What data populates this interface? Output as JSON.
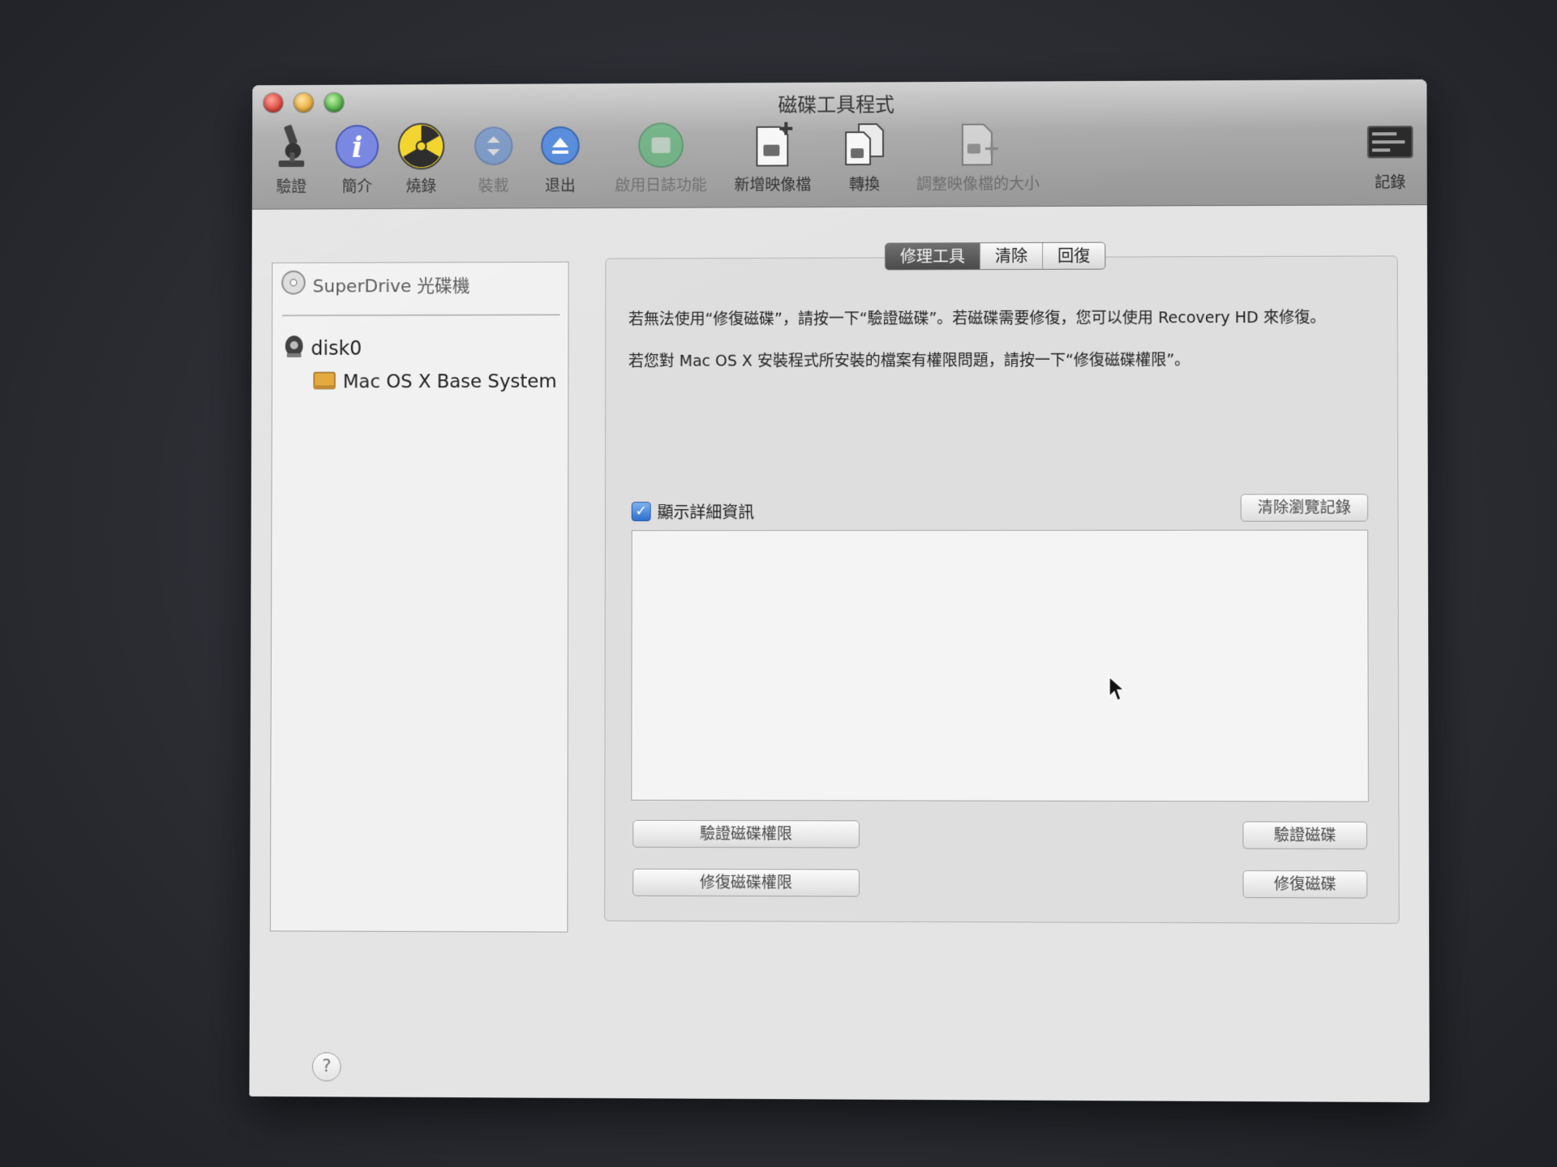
{
  "window": {
    "title": "磁碟工具程式"
  },
  "toolbar": {
    "verify": "驗證",
    "info": "簡介",
    "burn": "燒錄",
    "mount": "裝載",
    "eject": "退出",
    "journaling": "啟用日誌功能",
    "new_image": "新增映像檔",
    "convert": "轉換",
    "resize_image": "調整映像檔的大小",
    "log": "記錄"
  },
  "sidebar": {
    "optical": "SuperDrive 光碟機",
    "disk": "disk0",
    "volume": "Mac OS X Base System"
  },
  "tabs": {
    "first_aid": "修理工具",
    "erase": "清除",
    "restore": "回復"
  },
  "first_aid": {
    "desc1": "若無法使用“修復磁碟”，請按一下“驗證磁碟”。若磁碟需要修復，您可以使用 Recovery HD 來修復。",
    "desc2": "若您對 Mac OS X 安裝程式所安裝的檔案有權限問題，請按一下“修復磁碟權限”。",
    "show_details": "顯示詳細資訊",
    "clear_history": "清除瀏覽記錄",
    "verify_permissions": "驗證磁碟權限",
    "repair_permissions": "修復磁碟權限",
    "verify_disk": "驗證磁碟",
    "repair_disk": "修復磁碟"
  },
  "help": {
    "label": "?"
  },
  "colors": {
    "active_tab": "#4a4a4a",
    "checkbox": "#2f6fd0"
  }
}
